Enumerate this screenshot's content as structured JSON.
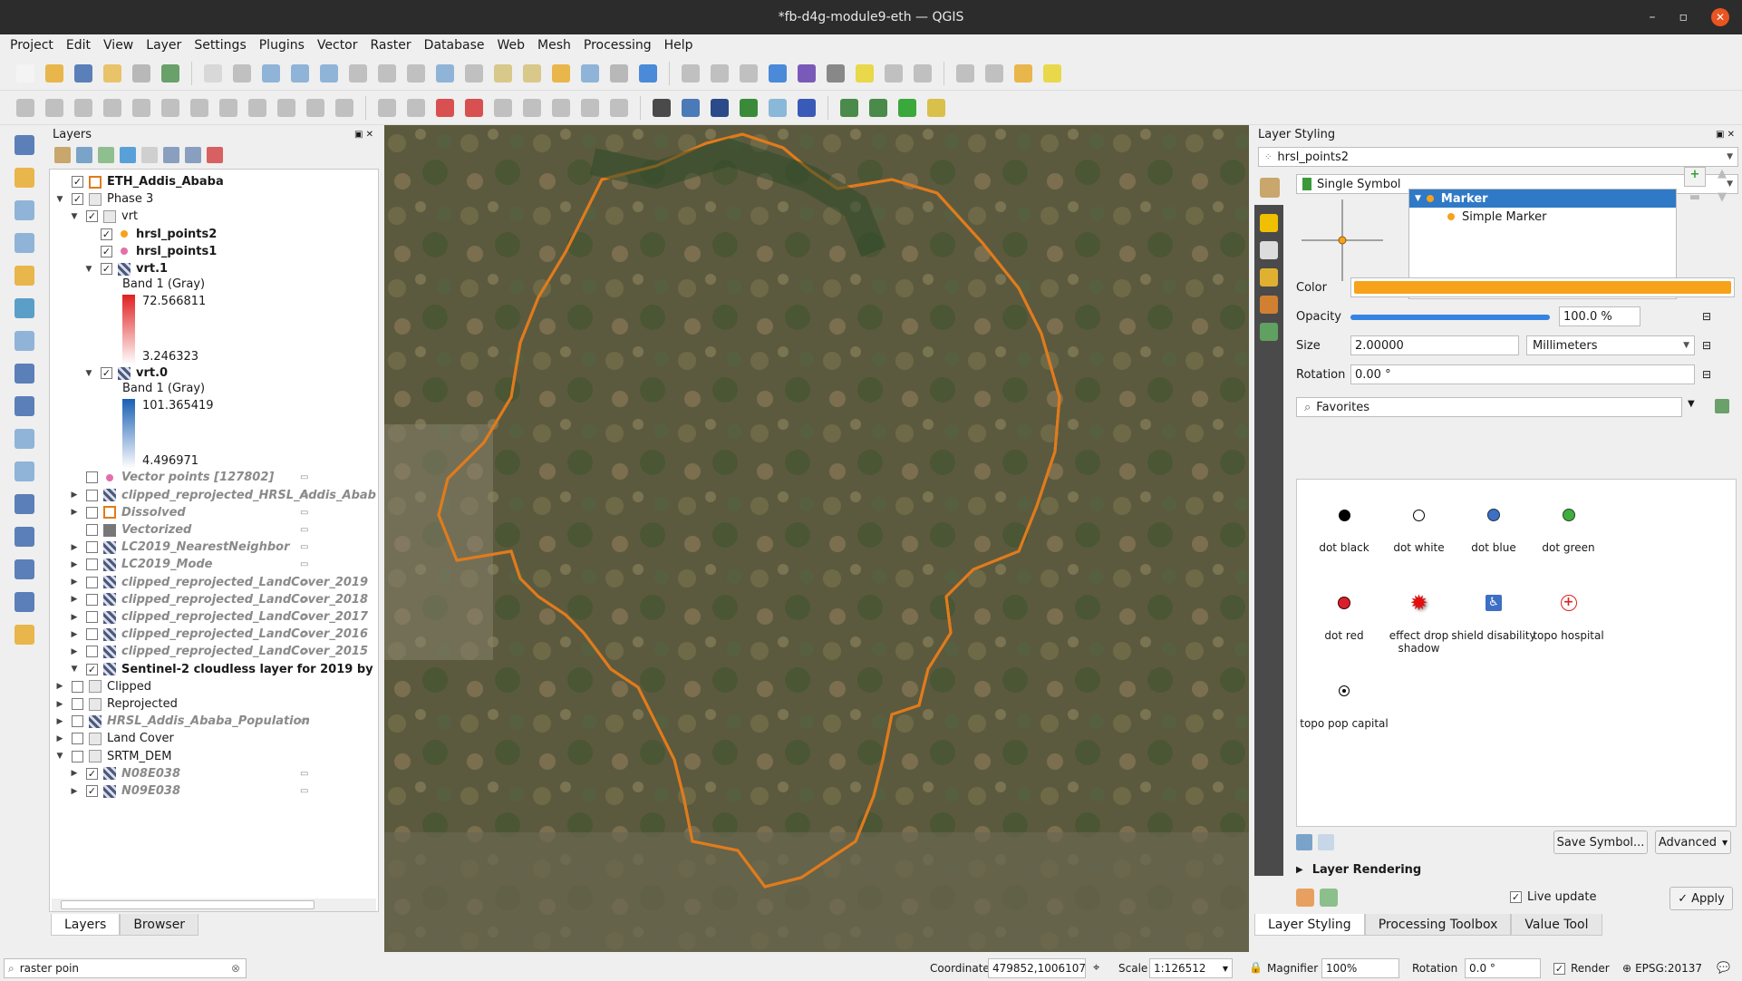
{
  "window": {
    "title": "*fb-d4g-module9-eth — QGIS"
  },
  "menu": [
    "Project",
    "Edit",
    "View",
    "Layer",
    "Settings",
    "Plugins",
    "Vector",
    "Raster",
    "Database",
    "Web",
    "Mesh",
    "Processing",
    "Help"
  ],
  "layers_panel": {
    "title": "Layers",
    "tree": [
      {
        "label": "ETH_Addis_Ababa",
        "style": "b",
        "checked": true,
        "indent": 1,
        "icon": "poly"
      },
      {
        "label": "Phase 3",
        "style": "",
        "checked": true,
        "indent": 1,
        "icon": "group",
        "arrow": "open"
      },
      {
        "label": "vrt",
        "style": "",
        "checked": true,
        "indent": 2,
        "icon": "group",
        "arrow": "open"
      },
      {
        "label": "hrsl_points2",
        "style": "b",
        "checked": true,
        "indent": 3,
        "icon": "pt-orange"
      },
      {
        "label": "hrsl_points1",
        "style": "b",
        "checked": true,
        "indent": 3,
        "icon": "pt-pink"
      },
      {
        "label": "vrt.1",
        "style": "b",
        "checked": true,
        "indent": 3,
        "icon": "raster",
        "arrow": "open"
      },
      {
        "label": "vrt.0",
        "style": "b",
        "checked": true,
        "indent": 3,
        "icon": "raster",
        "arrow": "open"
      },
      {
        "label": "Vector points [127802]",
        "style": "it",
        "checked": false,
        "indent": 2,
        "icon": "pt-pink"
      },
      {
        "label": "clipped_reprojected_HRSL_Addis_Abab",
        "style": "it",
        "checked": false,
        "indent": 2,
        "icon": "raster",
        "arrow": "closed"
      },
      {
        "label": "Dissolved",
        "style": "it",
        "checked": false,
        "indent": 2,
        "icon": "poly",
        "arrow": "closed"
      },
      {
        "label": "Vectorized",
        "style": "it",
        "checked": false,
        "indent": 2,
        "icon": "polyfill"
      },
      {
        "label": "LC2019_NearestNeighbor",
        "style": "it",
        "checked": false,
        "indent": 2,
        "icon": "raster",
        "arrow": "closed"
      },
      {
        "label": "LC2019_Mode",
        "style": "it",
        "checked": false,
        "indent": 2,
        "icon": "raster",
        "arrow": "closed"
      },
      {
        "label": "clipped_reprojected_LandCover_2019",
        "style": "it",
        "checked": false,
        "indent": 2,
        "icon": "raster",
        "arrow": "closed"
      },
      {
        "label": "clipped_reprojected_LandCover_2018",
        "style": "it",
        "checked": false,
        "indent": 2,
        "icon": "raster",
        "arrow": "closed"
      },
      {
        "label": "clipped_reprojected_LandCover_2017",
        "style": "it",
        "checked": false,
        "indent": 2,
        "icon": "raster",
        "arrow": "closed"
      },
      {
        "label": "clipped_reprojected_LandCover_2016",
        "style": "it",
        "checked": false,
        "indent": 2,
        "icon": "raster",
        "arrow": "closed"
      },
      {
        "label": "clipped_reprojected_LandCover_2015",
        "style": "it",
        "checked": false,
        "indent": 2,
        "icon": "raster",
        "arrow": "closed"
      },
      {
        "label": "Sentinel-2 cloudless layer for 2019 by",
        "style": "b",
        "checked": true,
        "indent": 2,
        "icon": "raster",
        "arrow": "open"
      },
      {
        "label": "Clipped",
        "style": "",
        "checked": false,
        "indent": 1,
        "icon": "group",
        "arrow": "closed"
      },
      {
        "label": "Reprojected",
        "style": "",
        "checked": false,
        "indent": 1,
        "icon": "group",
        "arrow": "closed"
      },
      {
        "label": "HRSL_Addis_Ababa_Population",
        "style": "it",
        "checked": false,
        "indent": 1,
        "icon": "raster",
        "arrow": "closed"
      },
      {
        "label": "Land Cover",
        "style": "",
        "checked": false,
        "indent": 1,
        "icon": "group",
        "arrow": "closed"
      },
      {
        "label": "SRTM_DEM",
        "style": "",
        "checked": false,
        "indent": 1,
        "icon": "group",
        "arrow": "open"
      },
      {
        "label": "N08E038",
        "style": "it",
        "checked": true,
        "indent": 2,
        "icon": "raster",
        "arrow": "closed"
      },
      {
        "label": "N09E038",
        "style": "it",
        "checked": true,
        "indent": 2,
        "icon": "raster",
        "arrow": "closed"
      }
    ],
    "legend_vrt1": {
      "band": "Band 1 (Gray)",
      "max": "72.566811",
      "min": "3.246323",
      "color": "#e02020"
    },
    "legend_vrt0": {
      "band": "Band 1 (Gray)",
      "max": "101.365419",
      "min": "4.496971",
      "color": "#1a5fb4"
    },
    "tabs": [
      "Layers",
      "Browser"
    ]
  },
  "styling": {
    "title": "Layer Styling",
    "layer": "hrsl_points2",
    "renderer": "Single Symbol",
    "tree": [
      "Marker",
      "Simple Marker"
    ],
    "color_label": "Color",
    "color": "#f7a21b",
    "opacity_label": "Opacity",
    "opacity_value": "100.0 %",
    "opacity": 1.0,
    "size_label": "Size",
    "size_value": "2.00000",
    "unit": "Millimeters",
    "rotation_label": "Rotation",
    "rotation_value": "0.00 °",
    "search": "Favorites",
    "symbols": [
      {
        "label": "dot  black",
        "icon": "dot-black-icon",
        "color": "#000000"
      },
      {
        "label": "dot  white",
        "icon": "dot-white-icon",
        "color": "#ffffff"
      },
      {
        "label": "dot blue",
        "icon": "dot-blue-icon",
        "color": "#3d6fc4"
      },
      {
        "label": "dot green",
        "icon": "dot-green-icon",
        "color": "#3fae3f"
      },
      {
        "label": "dot red",
        "icon": "dot-red-icon",
        "color": "#d9202a"
      },
      {
        "label": "effect drop shadow",
        "icon": "starburst-icon",
        "color": "#e01010"
      },
      {
        "label": "shield disability",
        "icon": "wheelchair-icon",
        "color": "#3d6fc4"
      },
      {
        "label": "topo hospital",
        "icon": "hospital-cross-icon",
        "color": "#e02020"
      },
      {
        "label": "topo pop capital",
        "icon": "capital-dot-icon",
        "color": "#000000"
      }
    ],
    "save_symbol": "Save Symbol...",
    "advanced": "Advanced",
    "layer_rendering": "Layer Rendering",
    "live_update": "Live update",
    "apply": "Apply",
    "tabs": [
      "Layer Styling",
      "Processing Toolbox",
      "Value Tool"
    ]
  },
  "status": {
    "search": "raster poin",
    "coordinate_label": "Coordinate",
    "coordinate": "479852,1006107",
    "scale_label": "Scale",
    "scale": "1:126512",
    "magnifier_label": "Magnifier",
    "magnifier": "100%",
    "rotation_label": "Rotation",
    "rotation": "0.0 °",
    "render": "Render",
    "crs": "EPSG:20137"
  },
  "map": {
    "boundary_color": "#e07b1c",
    "points_left_color": "#e46fa8",
    "points_right_color": "#f7a21b"
  }
}
